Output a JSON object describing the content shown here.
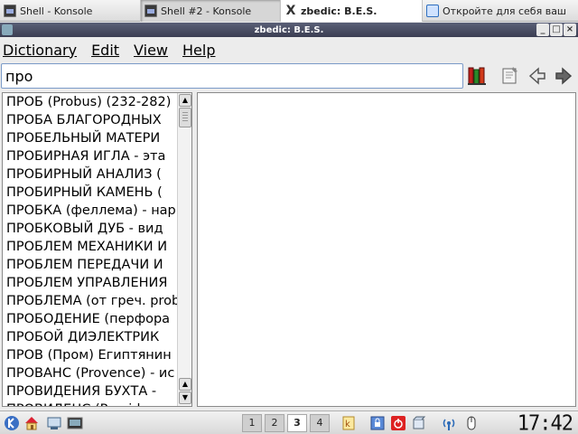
{
  "taskbar": {
    "tasks": [
      {
        "label": "Shell - Konsole",
        "icon": "konsole-icon"
      },
      {
        "label": "Shell #2 - Konsole",
        "icon": "konsole-icon"
      },
      {
        "label": "zbedic: B.E.S.",
        "icon": "x-icon"
      },
      {
        "label": "Откройте для себя ваш",
        "icon": "folder-icon"
      }
    ]
  },
  "window": {
    "title": "zbedic: B.E.S.",
    "buttons": [
      "_",
      "□",
      "×"
    ]
  },
  "menu": {
    "items": [
      "Dictionary",
      "Edit",
      "View",
      "Help"
    ]
  },
  "search": {
    "value": "про"
  },
  "word_list": [
    "ПРОБ (Probus) (232-282)",
    "ПРОБА БЛАГОРОДНЫХ",
    "ПРОБЕЛЬНЫЙ МАТЕРИ",
    "ПРОБИРНАЯ ИГЛА - эта",
    "ПРОБИРНЫЙ АНАЛИЗ (",
    "ПРОБИРНЫЙ КАМЕНЬ (",
    "ПРОБКА (феллема) - нар",
    "ПРОБКОВЫЙ ДУБ - вид",
    "ПРОБЛЕМ МЕХАНИКИ И",
    "ПРОБЛЕМ ПЕРЕДАЧИ И",
    "ПРОБЛЕМ УПРАВЛЕНИЯ",
    "ПРОБЛЕМА (от греч. prob",
    "ПРОБОДЕНИЕ (перфора",
    "ПРОБОЙ ДИЭЛЕКТРИК",
    "ПРОВ (Пром) Египтянин",
    "ПРОВАНС (Provence) - ис",
    "ПРОВИДЕНИЯ БУХТА -",
    "ПРОВИДЕНС (Providence"
  ],
  "panel": {
    "desktops": [
      "1",
      "2",
      "3",
      "4"
    ],
    "current_desktop": "3",
    "clock": "17:42"
  }
}
